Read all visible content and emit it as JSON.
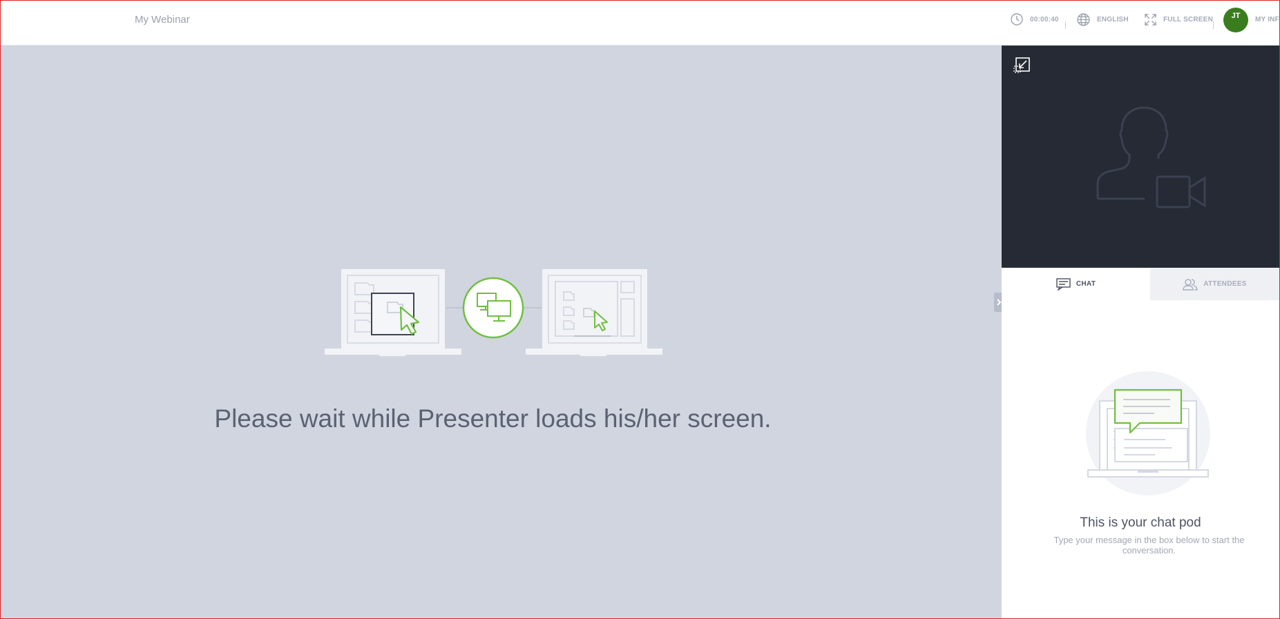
{
  "header": {
    "title": "My Webinar",
    "timer": "00:00:40",
    "language": "ENGLISH",
    "fullscreen": "FULL SCREEN",
    "avatar_initials": "JT",
    "my_info": "MY INFO"
  },
  "stage": {
    "message": "Please wait while Presenter loads his/her screen."
  },
  "side": {
    "tabs": [
      {
        "label": "CHAT",
        "icon": "chat-icon",
        "active": true
      },
      {
        "label": "ATTENDEES",
        "icon": "attendees-icon",
        "active": false
      }
    ],
    "chat_title": "This is your chat pod",
    "chat_subtitle": "Type your message in the box below to start the conversation."
  },
  "colors": {
    "accent_green": "#6fbf3f",
    "avatar_green": "#3a7d1f",
    "stage_bg": "#d1d5df",
    "video_bg": "#252a35"
  }
}
